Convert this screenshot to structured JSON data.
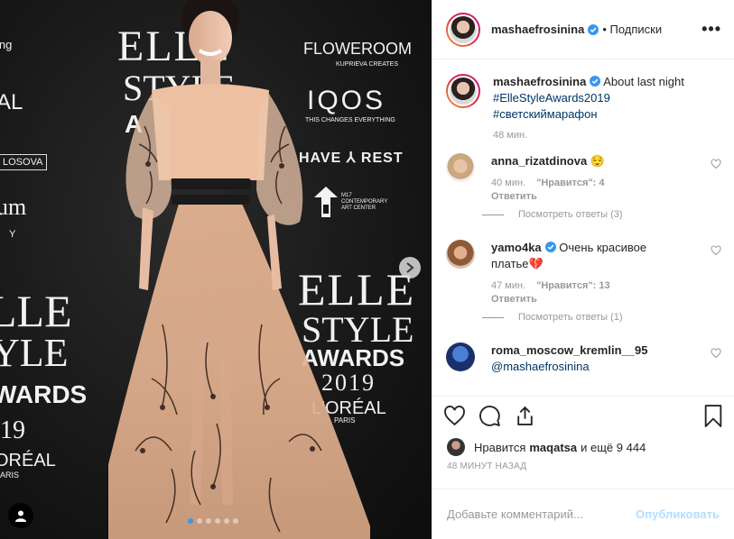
{
  "photo": {
    "wall_logos": {
      "elle_top": "ELLE",
      "style_top": "STYLE",
      "awards_top": "A",
      "floweroom": "FLOWEROOM",
      "floweroom_sub": "KUPRIEVA CREATES",
      "iqos": "IQOS",
      "iqos_sub": "THIS CHANGES EVERYTHING",
      "have_rest": "HAVE ⅄ REST",
      "m17": "M17 CONTEMPORARY ART CENTER",
      "elle_bottom": "ELLE",
      "style_bottom": "STYLE",
      "awards_bottom": "AWARDS",
      "year": "2019",
      "loreal": "L'ORÉAL",
      "loreal_sub": "PARIS",
      "left_elle": "LLE",
      "left_style": "YLE",
      "left_awards": "WARDS",
      "left_year": "19",
      "left_loreal": "ORÉAL",
      "left_paris": "ARIS",
      "left_losova": "LOSOVA",
      "left_al": "AL",
      "left_um": "um",
      "left_y": "Y",
      "left_ring": "ing"
    },
    "carousel_dots": 6,
    "active_dot": 0
  },
  "header": {
    "username": "mashaefrosinina",
    "follow_label": "• Подписки",
    "more_label": "•••"
  },
  "caption": {
    "username": "mashaefrosinina",
    "text": "About last night",
    "tags": [
      "#ElleStyleAwards2019",
      "#светскиймарафон"
    ],
    "time": "48 мин."
  },
  "comments": [
    {
      "username": "anna_rizatdinova",
      "text": "😌",
      "time": "40 мин.",
      "likes": "\"Нравится\": 4",
      "reply_label": "Ответить",
      "view_replies": "Посмотреть ответы (3)"
    },
    {
      "username": "yamo4ka",
      "text": "Очень красивое платье💔",
      "time": "47 мин.",
      "likes": "\"Нравится\": 13",
      "reply_label": "Ответить",
      "view_replies": "Посмотреть ответы (1)"
    },
    {
      "username": "roma_moscow_kremlin__95",
      "text": "@mashaefrosinina"
    }
  ],
  "likes": {
    "prefix": "Нравится",
    "user": "maqatsa",
    "suffix": "и ещё 9 444"
  },
  "post_time": "48 МИНУТ НАЗАД",
  "add_comment": {
    "placeholder": "Добавьте комментарий...",
    "publish_label": "Опубликовать"
  },
  "colors": {
    "verified": "#3897f0",
    "link": "#003569",
    "publish_disabled": "#b2dffc",
    "muted": "#999999"
  }
}
